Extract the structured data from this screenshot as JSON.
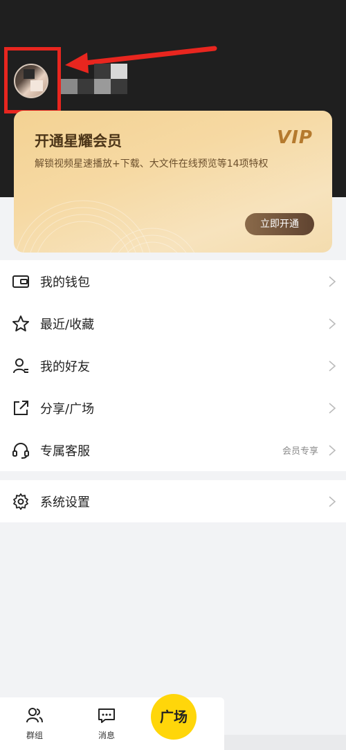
{
  "profile": {
    "avatar_icon": "user-avatar"
  },
  "vip_card": {
    "title": "开通星耀会员",
    "logo": "VIP",
    "subtitle": "解锁视频星速播放+下载、大文件在线预览等14项特权",
    "button": "立即开通"
  },
  "menu": {
    "items": [
      {
        "label": "我的钱包",
        "icon": "wallet-icon"
      },
      {
        "label": "最近/收藏",
        "icon": "star-icon"
      },
      {
        "label": "我的好友",
        "icon": "friends-icon"
      },
      {
        "label": "分享/广场",
        "icon": "share-icon"
      },
      {
        "label": "专属客服",
        "icon": "headset-icon",
        "extra": "会员专享"
      }
    ],
    "settings": {
      "label": "系统设置",
      "icon": "gear-icon"
    }
  },
  "bottom_nav": {
    "tabs": [
      {
        "label": "群组",
        "icon": "group-icon"
      },
      {
        "label": "消息",
        "icon": "message-icon"
      }
    ],
    "center": "广场"
  },
  "colors": {
    "accent_yellow": "#ffd60a",
    "highlight_red": "#e8261f",
    "header_bg": "#1f1f1f"
  }
}
